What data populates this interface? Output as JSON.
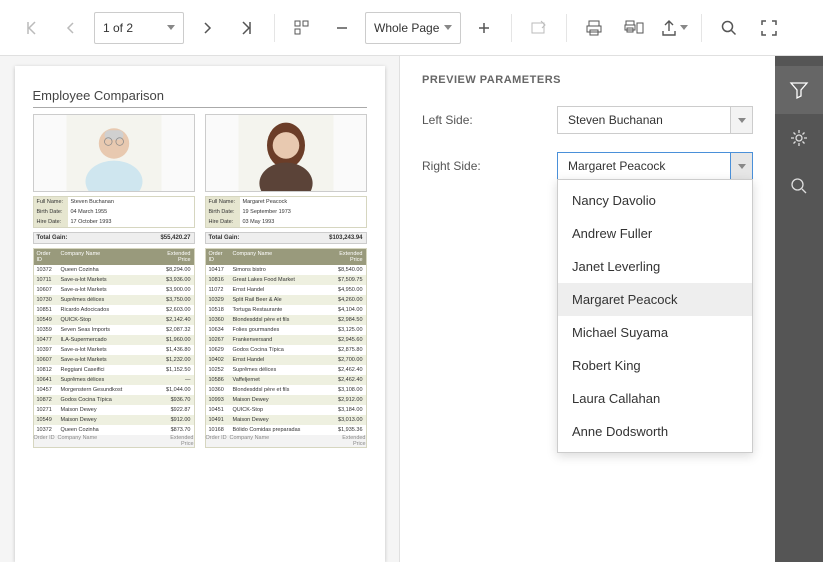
{
  "toolbar": {
    "page_display": "1 of 2",
    "zoom_mode": "Whole Page"
  },
  "document": {
    "title": "Employee Comparison",
    "rows_label": {
      "full_name": "Full Name:",
      "birth_date": "Birth Date:",
      "hire_date": "Hire Date:"
    },
    "total_gain_label": "Total Gain:",
    "table_headers": {
      "order_id": "Order ID",
      "company_name": "Company Name",
      "extended_price": "Extended Price"
    },
    "left": {
      "full_name": "Steven Buchanan",
      "birth_date": "04 March 1955",
      "hire_date": "17 October 1993",
      "total_gain": "$55,420.27",
      "rows": [
        {
          "id": "10372",
          "name": "Queen Cozinha",
          "price": "$8,294.00"
        },
        {
          "id": "10711",
          "name": "Save-a-lot Markets",
          "price": "$3,936.00"
        },
        {
          "id": "10607",
          "name": "Save-a-lot Markets",
          "price": "$3,900.00"
        },
        {
          "id": "10730",
          "name": "Suprêmes délices",
          "price": "$3,750.00"
        },
        {
          "id": "10851",
          "name": "Ricardo Adocicados",
          "price": "$2,603.00"
        },
        {
          "id": "10549",
          "name": "QUICK-Stop",
          "price": "$2,142.40"
        },
        {
          "id": "10359",
          "name": "Seven Seas Imports",
          "price": "$2,087.32"
        },
        {
          "id": "10477",
          "name": "ILA-Supermercado",
          "price": "$1,960.00"
        },
        {
          "id": "10397",
          "name": "Save-a-lot Markets",
          "price": "$1,436.80"
        },
        {
          "id": "10607",
          "name": "Save-a-lot Markets",
          "price": "$1,232.00"
        },
        {
          "id": "10812",
          "name": "Reggiani Caseifici",
          "price": "$1,152.50"
        },
        {
          "id": "10641",
          "name": "Suprêmes délices",
          "price": "—"
        },
        {
          "id": "10457",
          "name": "Morgenstern Gesundkost",
          "price": "$1,044.00"
        },
        {
          "id": "10872",
          "name": "Godos Cocina Típica",
          "price": "$936.70"
        },
        {
          "id": "10271",
          "name": "Maison Dewey",
          "price": "$922.87"
        },
        {
          "id": "10549",
          "name": "Maison Dewey",
          "price": "$912.00"
        },
        {
          "id": "10372",
          "name": "Queen Cozinha",
          "price": "$873.70"
        }
      ]
    },
    "right": {
      "full_name": "Margaret Peacock",
      "birth_date": "19 September 1973",
      "hire_date": "03 May 1993",
      "total_gain": "$103,243.94",
      "rows": [
        {
          "id": "10417",
          "name": "Simons bistro",
          "price": "$8,540.00"
        },
        {
          "id": "10816",
          "name": "Great Lakes Food Market",
          "price": "$7,509.75"
        },
        {
          "id": "11072",
          "name": "Ernst Handel",
          "price": "$4,950.00"
        },
        {
          "id": "10329",
          "name": "Split Rail Beer & Ale",
          "price": "$4,260.00"
        },
        {
          "id": "10518",
          "name": "Tortuga Restaurante",
          "price": "$4,104.00"
        },
        {
          "id": "10360",
          "name": "Blondesddsl père et fils",
          "price": "$2,984.50"
        },
        {
          "id": "10634",
          "name": "Folies gourmandes",
          "price": "$3,125.00"
        },
        {
          "id": "10267",
          "name": "Frankenversand",
          "price": "$2,945.60"
        },
        {
          "id": "10629",
          "name": "Godos Cocina Típica",
          "price": "$2,875.80"
        },
        {
          "id": "10402",
          "name": "Ernst Handel",
          "price": "$2,700.00"
        },
        {
          "id": "10252",
          "name": "Suprêmes délices",
          "price": "$2,462.40"
        },
        {
          "id": "10586",
          "name": "Vaffeljernet",
          "price": "$2,462.40"
        },
        {
          "id": "10360",
          "name": "Blondesddsl père et fils",
          "price": "$3,108.00"
        },
        {
          "id": "10993",
          "name": "Maison Dewey",
          "price": "$2,912.00"
        },
        {
          "id": "10451",
          "name": "QUICK-Stop",
          "price": "$3,184.00"
        },
        {
          "id": "10491",
          "name": "Maison Dewey",
          "price": "$3,013.00"
        },
        {
          "id": "10168",
          "name": "Bólido Comidas preparadas",
          "price": "$1,935.36"
        }
      ]
    }
  },
  "params": {
    "title": "PREVIEW PARAMETERS",
    "left_label": "Left Side:",
    "right_label": "Right Side:",
    "left_value": "Steven Buchanan",
    "right_value": "Margaret Peacock",
    "options": [
      "Nancy Davolio",
      "Andrew Fuller",
      "Janet Leverling",
      "Margaret Peacock",
      "Michael Suyama",
      "Robert King",
      "Laura Callahan",
      "Anne Dodsworth"
    ]
  }
}
